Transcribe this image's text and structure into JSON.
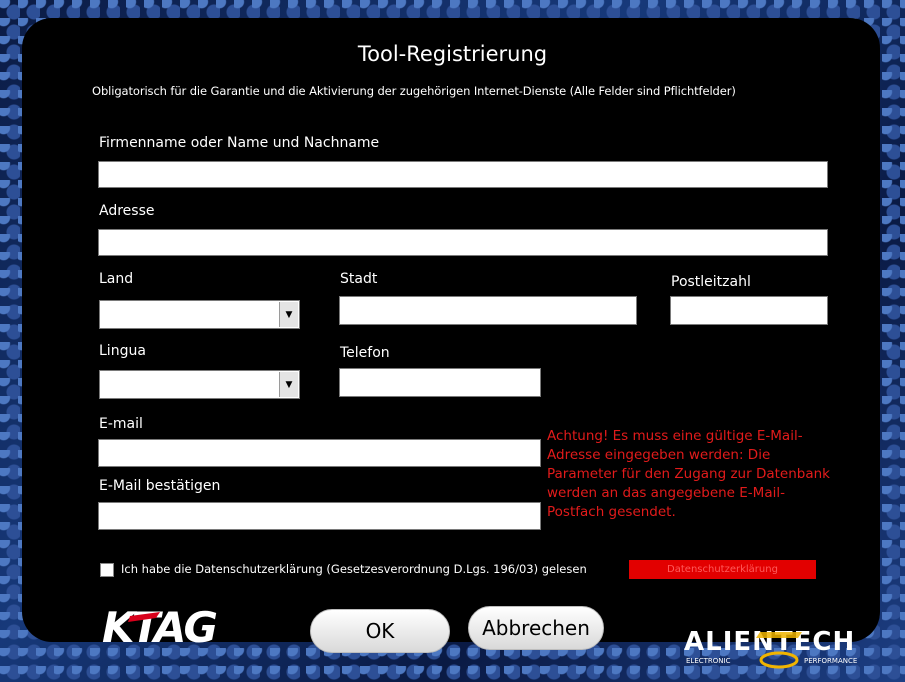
{
  "dialog": {
    "title": "Tool-Registrierung",
    "subtitle": "Obligatorisch für die Garantie und die Aktivierung der zugehörigen Internet-Dienste (Alle Felder sind Pflichtfelder)"
  },
  "form": {
    "name_label": "Firmenname oder Name und Nachname",
    "name_value": "",
    "address_label": "Adresse",
    "address_value": "",
    "country_label": "Land",
    "country_value": "",
    "city_label": "Stadt",
    "city_value": "",
    "zip_label": "Postleitzahl",
    "zip_value": "",
    "language_label": "Lingua",
    "language_value": "",
    "phone_label": "Telefon",
    "phone_value": "",
    "email_label": "E-mail",
    "email_value": "",
    "email_confirm_label": "E-Mail bestätigen",
    "email_confirm_value": ""
  },
  "warning_text": "Achtung! Es muss eine gültige E-Mail-Adresse eingegeben werden: Die Parameter für den Zugang zur Datenbank werden an das angegebene E-Mail-Postfach gesendet.",
  "privacy": {
    "checkbox_label": "Ich habe die Datenschutzerklärung (Gesetzesverordnung D.Lgs. 196/03) gelesen",
    "checked": false,
    "button_label": "Datenschutzerklärung"
  },
  "buttons": {
    "ok": "OK",
    "cancel": "Abbrechen"
  },
  "logos": {
    "ktag": "KTAG",
    "alientech": "ALIENTECH",
    "alientech_left_tagline": "ELECTRONIC",
    "alientech_right_tagline": "PERFORMANCE"
  },
  "colors": {
    "warning": "#e21b1b",
    "privacy_button": "#e20000"
  }
}
